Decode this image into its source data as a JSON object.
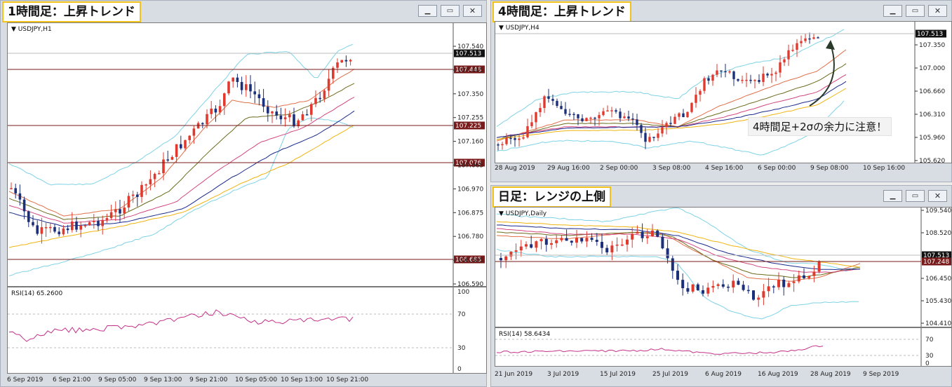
{
  "colors": {
    "bull": "#e03a2e",
    "bear": "#1b2f7a",
    "bb": "#7fd3e6",
    "sma_fast": "#e0704a",
    "sma2": "#6b6b1e",
    "sma3": "#d2457f",
    "sma4": "#1a2a8c",
    "sma5": "#f0b40f",
    "level": "#7a1b1b",
    "rsi": "#c3318a",
    "title_border": "#f2c31c"
  },
  "windows": [
    {
      "id": "h1",
      "title": "1時間足：上昇トレンド",
      "symbol": "USDJPY,H1",
      "current_price": "107.513",
      "price_axis": [
        "107.540",
        "107.445",
        "107.350",
        "107.255",
        "107.160",
        "107.065",
        "106.970",
        "106.875",
        "106.780",
        "106.685",
        "106.590"
      ],
      "levels": [
        "107.448",
        "107.225",
        "107.076",
        "106.685"
      ],
      "rsi_label": "RSI(14) 65.2600",
      "rsi_axis": [
        "100",
        "70",
        "30",
        "0"
      ],
      "time_axis": [
        "6 Sep 2019",
        "6 Sep 21:00",
        "9 Sep 05:00",
        "9 Sep 13:00",
        "9 Sep 21:00",
        "10 Sep 05:00",
        "10 Sep 13:00",
        "10 Sep 21:00"
      ]
    },
    {
      "id": "h4",
      "title": "4時間足：上昇トレンド",
      "symbol": "USDJPY,H4",
      "current_price": "107.513",
      "price_axis": [
        "107.350",
        "107.000",
        "106.660",
        "106.310",
        "105.960",
        "105.620"
      ],
      "note": "4時間足+2σの余力に注意！",
      "time_axis": [
        "28 Aug 2019",
        "29 Aug 16:00",
        "2 Sep 00:00",
        "3 Sep 08:00",
        "4 Sep 16:00",
        "6 Sep 00:00",
        "9 Sep 08:00",
        "10 Sep 16:00"
      ]
    },
    {
      "id": "d1",
      "title": "日足：レンジの上側",
      "symbol": "USDJPY,Daily",
      "current_price": "107.513",
      "level": "107.248",
      "price_axis": [
        "109.540",
        "108.520",
        "106.450",
        "105.430",
        "104.410"
      ],
      "rsi_label": "RSI(14) 58.6434",
      "rsi_axis": [
        "70",
        "30",
        "0"
      ],
      "time_axis": [
        "21 Jun 2019",
        "3 Jul 2019",
        "15 Jul 2019",
        "25 Jul 2019",
        "6 Aug 2019",
        "16 Aug 2019",
        "28 Aug 2019",
        "9 Sep 2019"
      ]
    }
  ]
}
